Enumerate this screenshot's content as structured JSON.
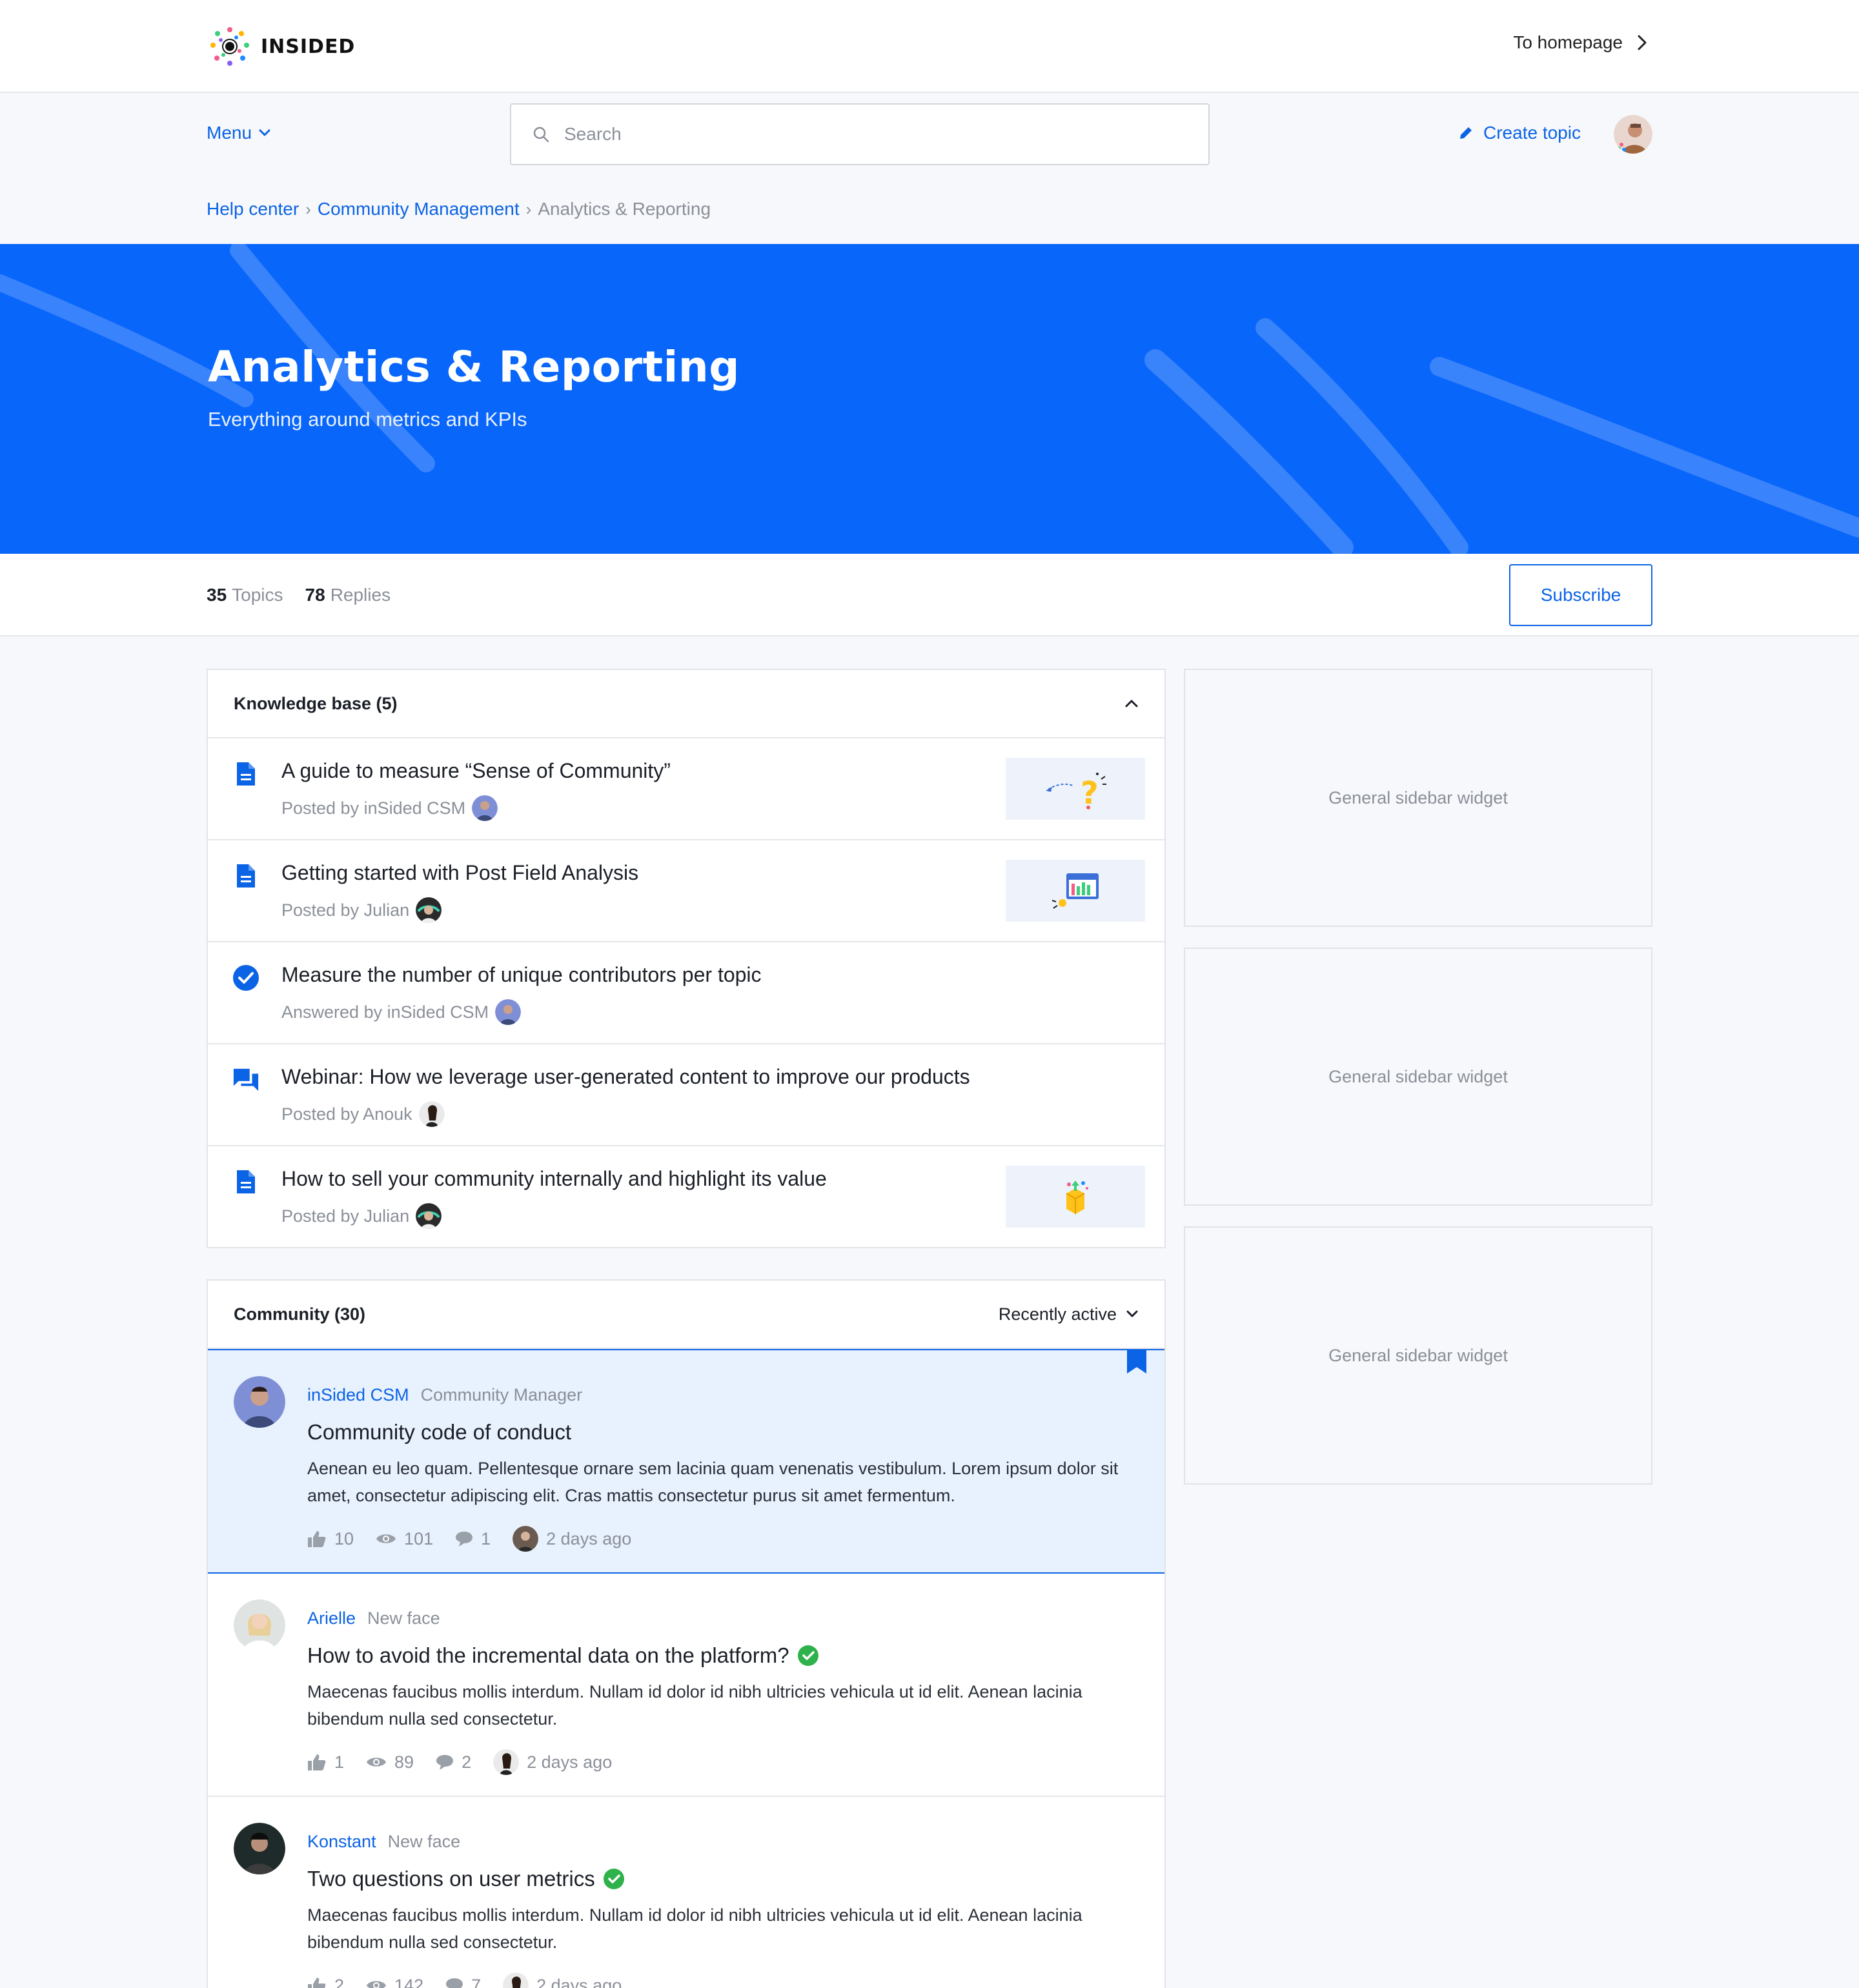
{
  "header": {
    "logo_text": "INSIDED",
    "to_homepage": "To homepage"
  },
  "nav": {
    "menu_label": "Menu",
    "search_placeholder": "Search",
    "create_topic": "Create topic"
  },
  "breadcrumb": {
    "items": [
      "Help center",
      "Community Management"
    ],
    "current": "Analytics & Reporting"
  },
  "hero": {
    "title": "Analytics & Reporting",
    "subtitle": "Everything around metrics and KPIs",
    "bg_color": "#0866fb"
  },
  "stats": {
    "topics_count": "35",
    "topics_label": "Topics",
    "replies_count": "78",
    "replies_label": "Replies",
    "subscribe_label": "Subscribe"
  },
  "knowledge_base": {
    "heading": "Knowledge base (5)",
    "items": [
      {
        "icon": "document-icon",
        "title": "A guide to measure “Sense of Community”",
        "meta": "Posted by inSided CSM"
      },
      {
        "icon": "document-icon",
        "title": "Getting started with Post Field Analysis",
        "meta": "Posted by Julian"
      },
      {
        "icon": "check-circle-icon",
        "title": "Measure the number of unique contributors per topic",
        "meta": "Answered by inSided CSM"
      },
      {
        "icon": "chat-icon",
        "title": "Webinar: How we leverage user-generated content to improve our products",
        "meta": "Posted by Anouk"
      },
      {
        "icon": "document-icon",
        "title": "How to sell your community internally and highlight its value",
        "meta": "Posted by Julian"
      }
    ]
  },
  "community": {
    "heading": "Community (30)",
    "sort_label": "Recently active",
    "posts": [
      {
        "author": "inSided CSM",
        "role": "Community Manager",
        "title": "Community code of conduct",
        "body": "Aenean eu leo quam. Pellentesque ornare sem lacinia quam venenatis vestibulum. Lorem ipsum dolor sit amet, consectetur adipiscing elit. Cras mattis consectetur purus sit amet fermentum.",
        "likes": "10",
        "views": "101",
        "replies": "1",
        "time": "2 days ago"
      },
      {
        "author": "Arielle",
        "role": "New face",
        "title": "How to avoid the incremental data on the platform?",
        "body": "Maecenas faucibus mollis interdum. Nullam id dolor id nibh ultricies vehicula ut id elit. Aenean lacinia bibendum nulla sed consectetur.",
        "likes": "1",
        "views": "89",
        "replies": "2",
        "time": "2 days ago"
      },
      {
        "author": "Konstant",
        "role": "New face",
        "title": "Two questions on user metrics",
        "body": "Maecenas faucibus mollis interdum. Nullam id dolor id nibh ultricies vehicula ut id elit. Aenean lacinia bibendum nulla sed consectetur.",
        "likes": "2",
        "views": "142",
        "replies": "7",
        "time": "2 days ago"
      }
    ]
  },
  "sidebar": {
    "widgets": [
      "General sidebar widget",
      "General sidebar widget",
      "General sidebar widget"
    ]
  },
  "colors": {
    "accent": "#0b63e5",
    "hero": "#0866fb",
    "answered": "#2fb14b"
  }
}
